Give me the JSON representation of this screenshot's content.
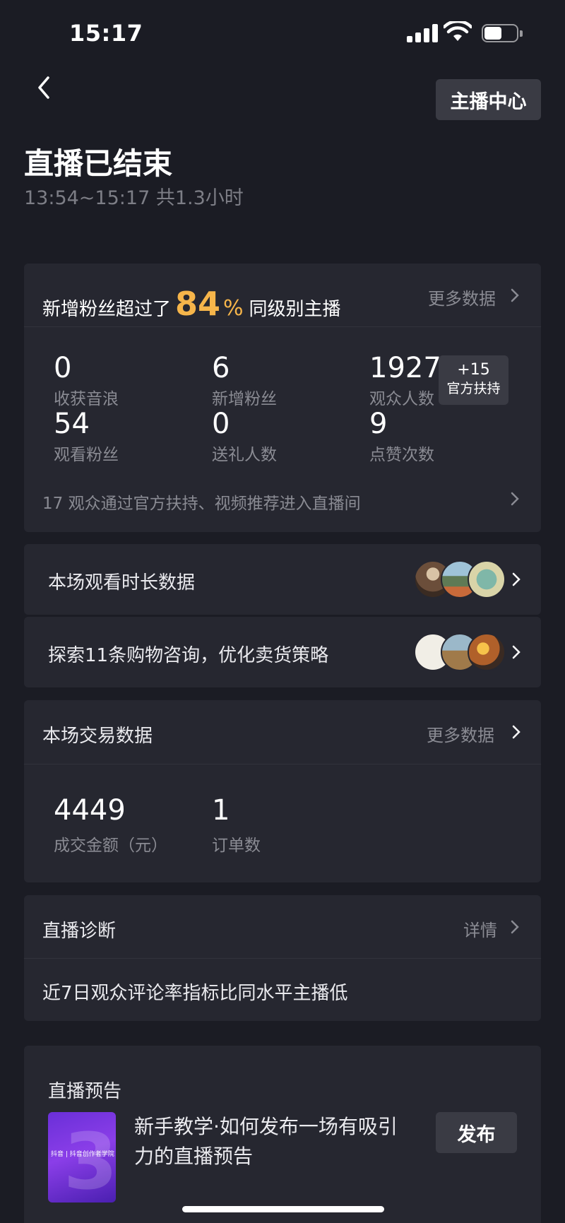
{
  "status": {
    "time": "15:17"
  },
  "header": {
    "anchor_center": "主播中心",
    "title": "直播已结束",
    "subtitle": "13:54~15:17 共1.3小时"
  },
  "fans_card": {
    "prefix": "新增粉丝超过了",
    "percent": "84",
    "percent_sym": "%",
    "suffix": "同级别主播",
    "more": "更多数据",
    "stats": [
      {
        "value": "0",
        "label": "收获音浪"
      },
      {
        "value": "6",
        "label": "新增粉丝"
      },
      {
        "value": "1927",
        "label": "观众人数"
      },
      {
        "value": "54",
        "label": "观看粉丝"
      },
      {
        "value": "0",
        "label": "送礼人数"
      },
      {
        "value": "9",
        "label": "点赞次数"
      }
    ],
    "boost": {
      "plus": "+15",
      "label": "官方扶持"
    },
    "footer": "17 观众通过官方扶持、视频推荐进入直播间"
  },
  "watch_row": {
    "label": "本场观看时长数据"
  },
  "shop_row": {
    "label": "探索11条购物咨询，优化卖货策略"
  },
  "trade_card": {
    "title": "本场交易数据",
    "more": "更多数据",
    "stats": [
      {
        "value": "4449",
        "label": "成交金额（元）"
      },
      {
        "value": "1",
        "label": "订单数"
      }
    ]
  },
  "diagnosis": {
    "title": "直播诊断",
    "more": "详情",
    "text": "近7日观众评论率指标比同水平主播低"
  },
  "preview": {
    "title": "直播预告",
    "thumb_tag": "抖音 | 抖音创作者学院",
    "thumb_big": "3",
    "desc": "新手教学·如何发布一场有吸引力的直播预告",
    "publish": "发布"
  },
  "colors": {
    "background": "#1b1c24",
    "card": "#262730",
    "accent": "#f6b54a"
  }
}
